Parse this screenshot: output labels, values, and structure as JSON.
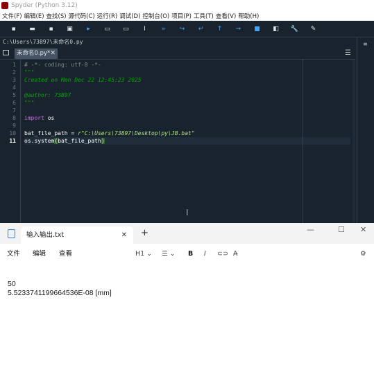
{
  "spyder": {
    "title": "Spyder (Python 3.12)",
    "menu": [
      "文件(F)",
      "编辑(E)",
      "查找(S)",
      "源代码(C)",
      "运行(R)",
      "调试(D)",
      "控制台(O)",
      "项目(P)",
      "工具(T)",
      "查看(V)",
      "帮助(H)"
    ],
    "toolbar": [
      {
        "name": "new-file-icon",
        "glyph": "▪"
      },
      {
        "name": "open-file-icon",
        "glyph": "▬"
      },
      {
        "name": "save-icon",
        "glyph": "▪"
      },
      {
        "name": "save-all-icon",
        "glyph": "▣"
      },
      {
        "name": "run-icon",
        "glyph": "▸",
        "accent": true
      },
      {
        "name": "run-cell-icon",
        "glyph": "▭"
      },
      {
        "name": "run-cell-advance-icon",
        "glyph": "▭"
      },
      {
        "name": "run-selection-icon",
        "glyph": "Ⅰ"
      },
      {
        "name": "debug-icon",
        "glyph": "»",
        "accent": true
      },
      {
        "name": "step-icon",
        "glyph": "↪",
        "accent": true
      },
      {
        "name": "step-into-icon",
        "glyph": "↵",
        "accent": true
      },
      {
        "name": "step-return-icon",
        "glyph": "↑",
        "accent": true
      },
      {
        "name": "continue-icon",
        "glyph": "➞",
        "accent": true
      },
      {
        "name": "stop-debug-icon",
        "glyph": "■",
        "accent": true
      },
      {
        "name": "maximize-pane-icon",
        "glyph": "◧"
      },
      {
        "name": "preferences-icon",
        "glyph": "🔧"
      },
      {
        "name": "python-path-icon",
        "glyph": "✎"
      }
    ],
    "path": "C:\\Users\\73897\\未命名0.py",
    "tab_label": "未命名0.py*",
    "editor": {
      "line_numbers": [
        "1",
        "2",
        "3",
        "4",
        "5",
        "6",
        "7",
        "8",
        "9",
        "10",
        "11"
      ],
      "current_line_number": "11",
      "lines": {
        "l1": "# -*- coding: utf-8 -*-",
        "l2": "\"\"\"",
        "l3": "Created on Mon Dec 22 12:45:23 2025",
        "l4": "",
        "l5": "@author: 73897",
        "l6": "\"\"\"",
        "l7": "",
        "l8_kw": "import",
        "l8_rest": " os",
        "l9": "",
        "l10_code": "bat_file_path = ",
        "l10_str": "r\"C:\\Users\\73897\\Desktop\\py\\JB.bat\"",
        "l11_code": "os.system",
        "l11_open": "(",
        "l11_arg": "bat_file_path",
        "l11_close": ")"
      }
    }
  },
  "notepad": {
    "tab_title": "输入输出.txt",
    "menu": {
      "file": "文件",
      "edit": "编辑",
      "view": "查看"
    },
    "toolbar": {
      "heading": "H1",
      "bold": "B",
      "italic": "I"
    },
    "content": [
      "50",
      "5.5233741199664536E-08 [mm]"
    ]
  }
}
